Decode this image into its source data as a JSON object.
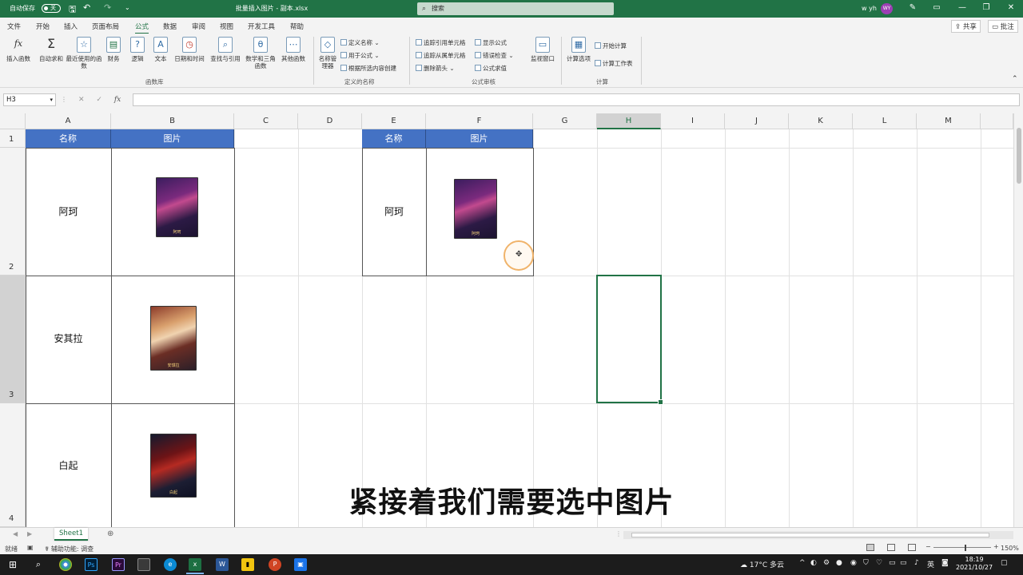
{
  "titlebar": {
    "autosave_label": "自动保存",
    "autosave_state": "关",
    "document_title": "批量插入图片 - 副本.xlsx",
    "search_placeholder": "搜索",
    "user_name": "w yh",
    "user_initials": "WY"
  },
  "menu": {
    "tabs": [
      "文件",
      "开始",
      "插入",
      "页面布局",
      "公式",
      "数据",
      "审阅",
      "视图",
      "开发工具",
      "帮助"
    ],
    "active_tab": "公式",
    "share_label": "共享",
    "comment_label": "批注"
  },
  "ribbon": {
    "function_library": {
      "buttons": [
        "插入函数",
        "自动求和",
        "最近使用的函数",
        "财务",
        "逻辑",
        "文本",
        "日期和时间",
        "查找与引用",
        "数学和三角函数",
        "其他函数"
      ],
      "group_label": "函数库"
    },
    "defined_names": {
      "name_manager": "名称管理器",
      "define_name": "定义名称",
      "use_in_formula": "用于公式",
      "create_from_selection": "根据所选内容创建",
      "group_label": "定义的名称"
    },
    "formula_auditing": {
      "trace_precedents": "追踪引用单元格",
      "trace_dependents": "追踪从属单元格",
      "remove_arrows": "删除箭头",
      "show_formulas": "显示公式",
      "error_checking": "错误检查",
      "evaluate_formula": "公式求值",
      "watch_window": "监视窗口",
      "group_label": "公式审核"
    },
    "calculation": {
      "calc_options": "计算选项",
      "calc_now": "开始计算",
      "calc_sheet": "计算工作表",
      "group_label": "计算"
    }
  },
  "formula_bar": {
    "name_box": "H3",
    "fx_label": "fx",
    "content": ""
  },
  "grid": {
    "columns": [
      "A",
      "B",
      "C",
      "D",
      "E",
      "F",
      "G",
      "H",
      "I",
      "J",
      "K",
      "L",
      "M"
    ],
    "rows": [
      "1",
      "2",
      "3",
      "4"
    ],
    "selected_column": "H",
    "selected_row": "3",
    "table1": {
      "headers": [
        "名称",
        "图片"
      ],
      "names": [
        "阿珂",
        "安其拉",
        "白起"
      ]
    },
    "table2": {
      "headers": [
        "名称",
        "图片"
      ],
      "names": [
        "阿珂"
      ]
    },
    "card_tags": [
      "阿珂",
      "安琪拉",
      "白起"
    ]
  },
  "subtitle": "紧接着我们需要选中图片",
  "sheets": {
    "tabs": [
      "Sheet1"
    ],
    "active": "Sheet1"
  },
  "statusbar": {
    "ready": "就绪",
    "accessibility": "辅助功能: 调查",
    "zoom": "150%"
  },
  "taskbar": {
    "weather": "17°C 多云",
    "ime": "英",
    "time": "18:19",
    "date": "2021/10/27"
  },
  "colors": {
    "excel_green": "#217346",
    "header_blue": "#4472c4"
  }
}
